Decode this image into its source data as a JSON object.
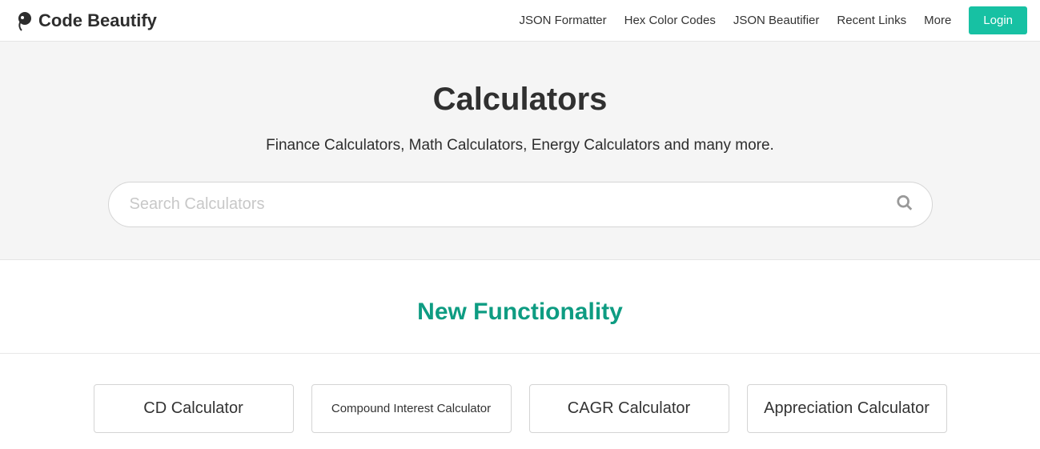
{
  "header": {
    "logo_text": "Code Beautify",
    "nav": [
      "JSON Formatter",
      "Hex Color Codes",
      "JSON Beautifier",
      "Recent Links",
      "More"
    ],
    "login_label": "Login"
  },
  "hero": {
    "title": "Calculators",
    "subtitle": "Finance Calculators, Math Calculators, Energy Calculators and many more.",
    "search_placeholder": "Search Calculators"
  },
  "section": {
    "title": "New Functionality",
    "cards": [
      "CD Calculator",
      "Compound Interest Calculator",
      "CAGR Calculator",
      "Appreciation Calculator"
    ]
  }
}
